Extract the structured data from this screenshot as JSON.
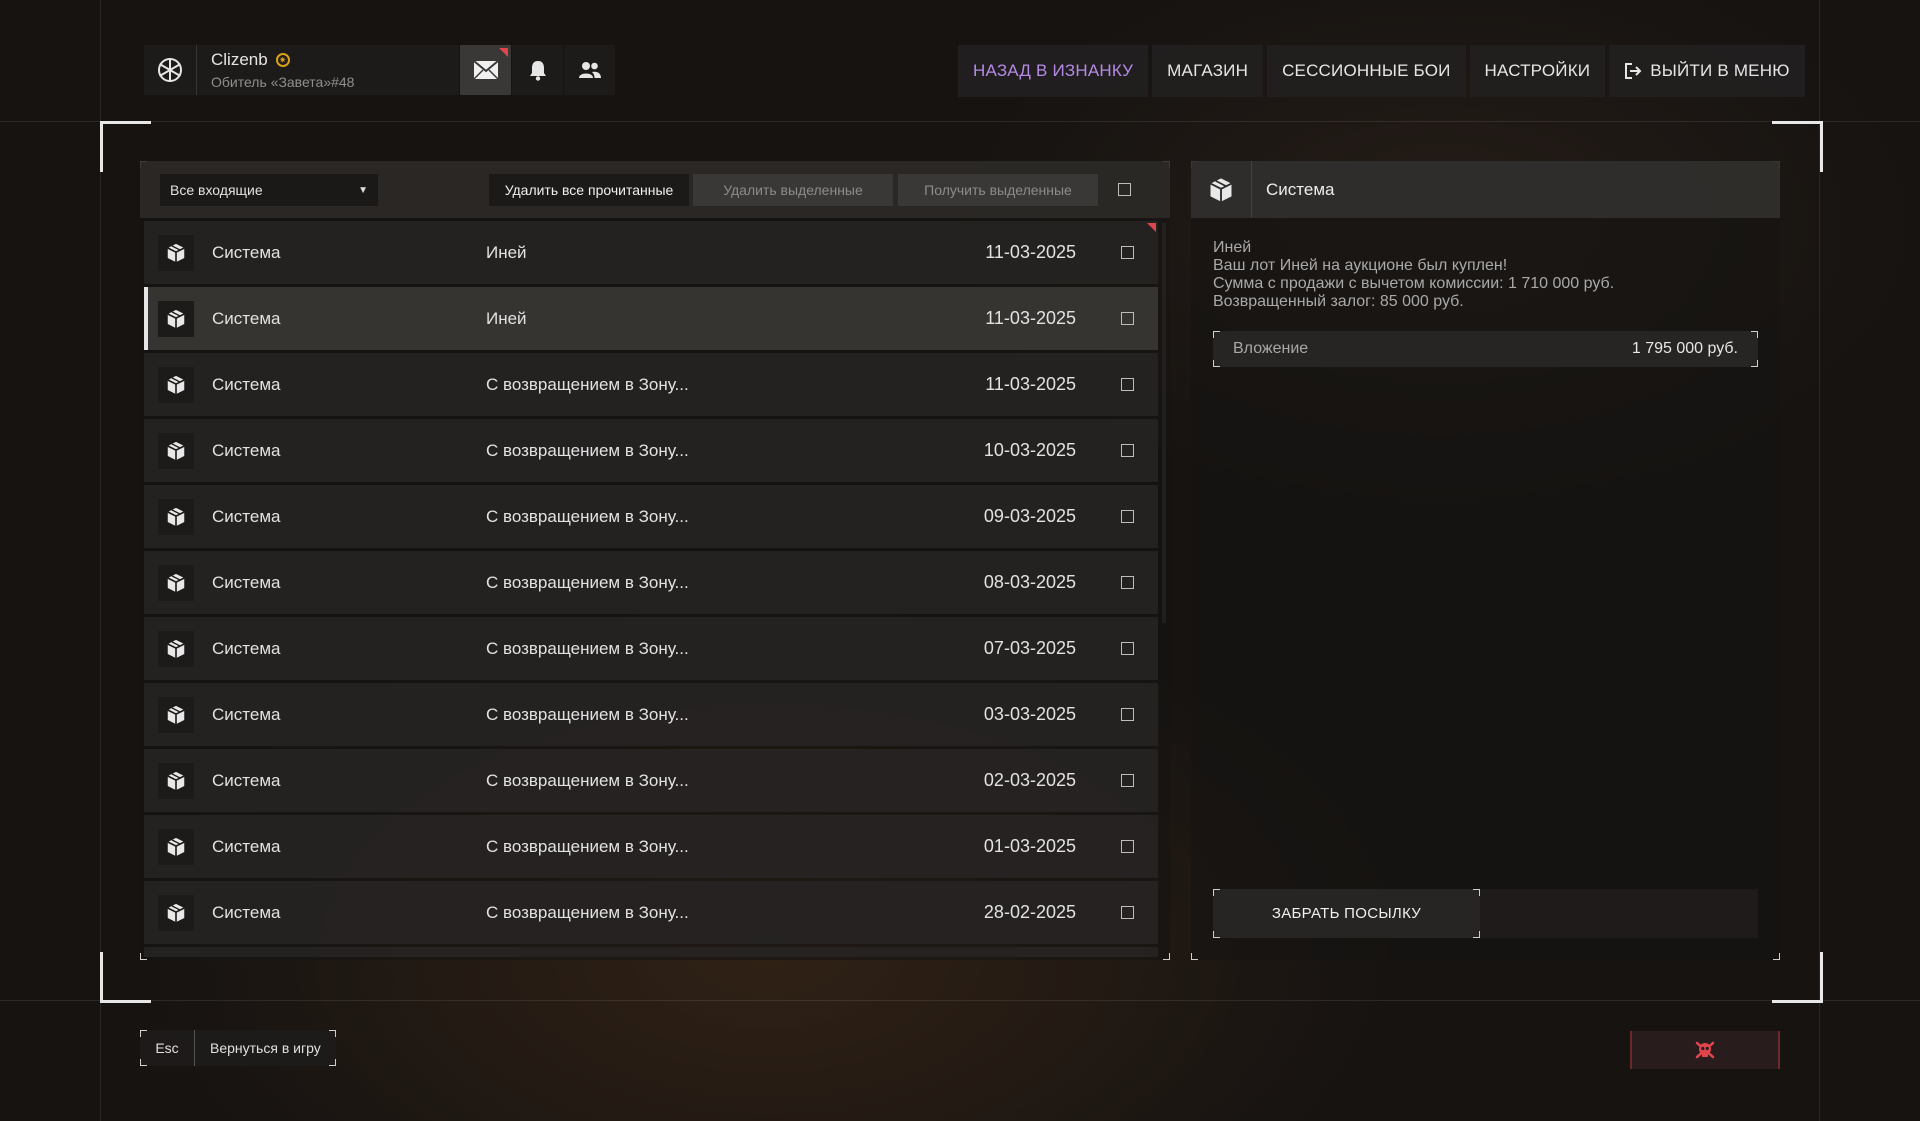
{
  "header": {
    "user": {
      "name": "Clizenb",
      "rank": "Обитель «Завета»#48",
      "logo_icon": "emblem-icon",
      "badge_icon": "sun-badge-icon"
    },
    "icons": [
      "mail-icon",
      "bell-icon",
      "friends-icon"
    ],
    "nav": {
      "back": "НАЗАД В ИЗНАНКУ",
      "shop": "МАГАЗИН",
      "sessions": "СЕССИОННЫЕ БОИ",
      "settings": "НАСТРОЙКИ",
      "exit": "ВЫЙТИ В МЕНЮ"
    },
    "accent_color": "#b58ae6"
  },
  "toolbar": {
    "filter_value": "Все входящие",
    "delete_read": "Удалить все прочитанные",
    "delete_selected": "Удалить выделенные",
    "receive_selected": "Получить выделенные"
  },
  "messages": [
    {
      "sender": "Система",
      "subject": "Иней",
      "date": "11-03-2025",
      "unread": true,
      "selected": false
    },
    {
      "sender": "Система",
      "subject": "Иней",
      "date": "11-03-2025",
      "unread": false,
      "selected": true
    },
    {
      "sender": "Система",
      "subject": "С возвращением в Зону...",
      "date": "11-03-2025",
      "unread": false,
      "selected": false
    },
    {
      "sender": "Система",
      "subject": "С возвращением в Зону...",
      "date": "10-03-2025",
      "unread": false,
      "selected": false
    },
    {
      "sender": "Система",
      "subject": "С возвращением в Зону...",
      "date": "09-03-2025",
      "unread": false,
      "selected": false
    },
    {
      "sender": "Система",
      "subject": "С возвращением в Зону...",
      "date": "08-03-2025",
      "unread": false,
      "selected": false
    },
    {
      "sender": "Система",
      "subject": "С возвращением в Зону...",
      "date": "07-03-2025",
      "unread": false,
      "selected": false
    },
    {
      "sender": "Система",
      "subject": "С возвращением в Зону...",
      "date": "03-03-2025",
      "unread": false,
      "selected": false
    },
    {
      "sender": "Система",
      "subject": "С возвращением в Зону...",
      "date": "02-03-2025",
      "unread": false,
      "selected": false
    },
    {
      "sender": "Система",
      "subject": "С возвращением в Зону...",
      "date": "01-03-2025",
      "unread": false,
      "selected": false
    },
    {
      "sender": "Система",
      "subject": "С возвращением в Зону...",
      "date": "28-02-2025",
      "unread": false,
      "selected": false
    }
  ],
  "detail": {
    "sender": "Система",
    "body_lines": [
      "Иней",
      "Ваш лот Иней на аукционе был куплен!",
      "Сумма с продажи с вычетом комиссии: 1 710 000 руб.",
      "Возвращенный залог: 85 000 руб."
    ],
    "attachment_label": "Вложение",
    "attachment_value": "1 795 000 руб.",
    "claim_button": "ЗАБРАТЬ ПОСЫЛКУ"
  },
  "footer": {
    "esc_key": "Esc",
    "esc_label": "Вернуться в игру",
    "skull_icon": "skull-icon",
    "danger_color": "#e0444c"
  }
}
